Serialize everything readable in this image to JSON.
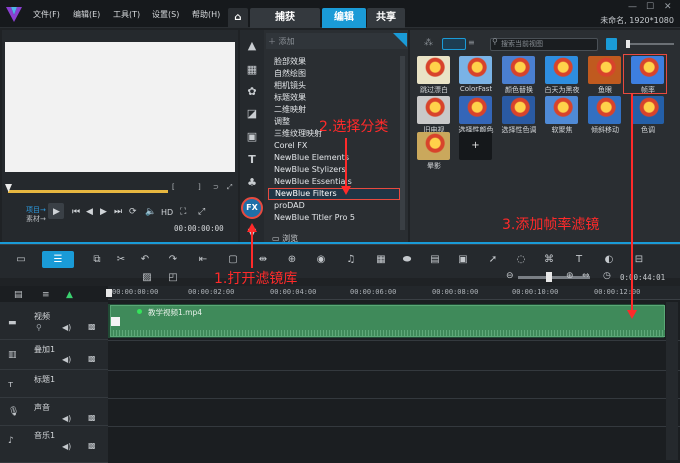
{
  "colors": {
    "accent": "#1a9bd7",
    "annotation": "#ff2a2a",
    "clip": "#3f8a5a"
  },
  "menu": [
    "文件(F)",
    "编辑(E)",
    "工具(T)",
    "设置(S)",
    "帮助(H)"
  ],
  "tabs": {
    "capture": "捕获",
    "edit": "编辑",
    "share": "共享"
  },
  "project": {
    "info": "未命名, 1920*1080"
  },
  "player": {
    "project_label": "项目→",
    "clip_label": "素材→",
    "hd": "HD",
    "timecode": "00:00:00:00"
  },
  "library": {
    "add_label": "添加",
    "browse_label": "浏览",
    "categories": [
      "脸部效果",
      "自然绘图",
      "相机镜头",
      "标题效果",
      "二维映射",
      "调整",
      "三维纹理映射",
      "Corel FX",
      "NewBlue Elements",
      "NewBlue Stylizers",
      "NewBlue Essentials",
      "NewBlue Filters",
      "proDAD",
      "NewBlue Titler Pro 5"
    ],
    "selected_category": "NewBlue Filters"
  },
  "gallery": {
    "search_placeholder": "搜索当前视图",
    "filters": [
      {
        "label": "跳过漂白"
      },
      {
        "label": "ColorFast"
      },
      {
        "label": "颜色替换"
      },
      {
        "label": "白天为黑夜"
      },
      {
        "label": "鱼眼"
      },
      {
        "label": "帧率"
      },
      {
        "label": "旧电视"
      },
      {
        "label": "选择性颜色"
      },
      {
        "label": "选择性色调"
      },
      {
        "label": "软聚焦"
      },
      {
        "label": "倾斜移动"
      },
      {
        "label": "色调"
      },
      {
        "label": "晕影"
      }
    ]
  },
  "timeline": {
    "duration": "0:00:44:01",
    "ruler": [
      "00:00:00:00",
      "00:00:02:00",
      "00:00:04:00",
      "00:00:06:00",
      "00:00:08:00",
      "00:00:10:00",
      "00:00:12:00"
    ],
    "tracks": [
      "视频",
      "叠加1",
      "标题1",
      "声音",
      "音乐1"
    ],
    "clip_name": "教学视频1.mp4"
  },
  "annotations": {
    "step1": "1.打开滤镜库",
    "step2": "2.选择分类",
    "step3": "3.添加帧率滤镜"
  }
}
